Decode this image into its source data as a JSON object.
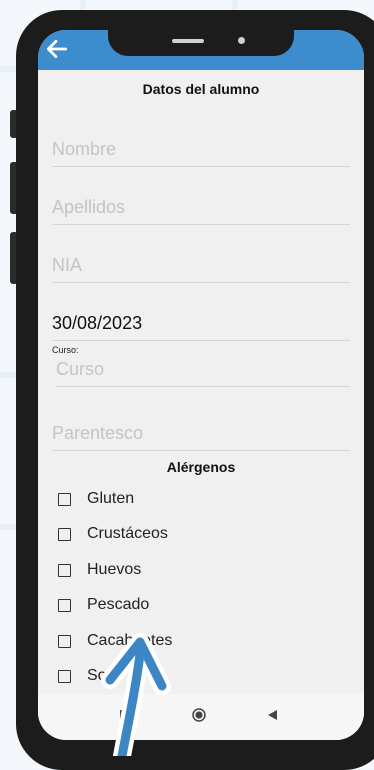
{
  "screen": {
    "title": "Datos del alumno",
    "back_icon": "arrow-left-icon"
  },
  "form": {
    "nombre_placeholder": "Nombre",
    "apellidos_placeholder": "Apellidos",
    "nia_placeholder": "NIA",
    "fecha_value": "30/08/2023",
    "curso_label": "Curso:",
    "curso_placeholder": "Curso",
    "parentesco_placeholder": "Parentesco"
  },
  "allergens": {
    "title": "Alérgenos",
    "items": [
      {
        "label": "Gluten",
        "checked": false
      },
      {
        "label": "Crustáceos",
        "checked": false
      },
      {
        "label": "Huevos",
        "checked": false
      },
      {
        "label": "Pescado",
        "checked": false
      },
      {
        "label": "Cacahuetes",
        "checked": false
      },
      {
        "label": "Soja",
        "checked": false
      }
    ]
  },
  "navbar": {
    "icons": [
      "recents-square-icon",
      "home-circle-icon",
      "back-triangle-icon"
    ]
  },
  "colors": {
    "appbar": "#3d8ccd",
    "overlay_arrow": "#3d86c6",
    "phone_frame": "#1c1c1c"
  }
}
